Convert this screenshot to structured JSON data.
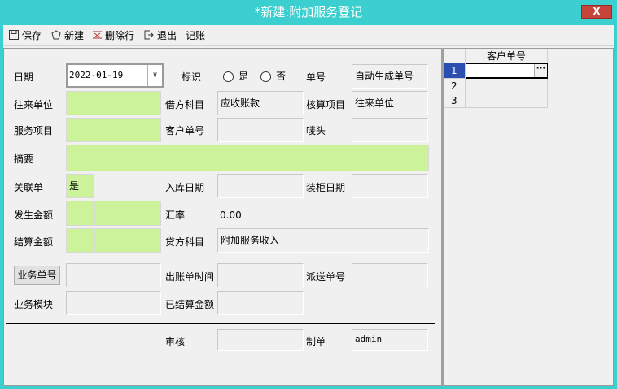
{
  "window": {
    "title": "*新建:附加服务登记",
    "close_label": "X"
  },
  "toolbar": {
    "save": "保存",
    "new": "新建",
    "delete_row": "删除行",
    "exit": "退出",
    "post": "记账"
  },
  "form": {
    "date_label": "日期",
    "date_value": "2022-01-19",
    "flag_label": "标识",
    "flag_yes": "是",
    "flag_no": "否",
    "order_no_label": "单号",
    "order_no_value": "自动生成单号",
    "partner_label": "往来单位",
    "partner_value": "",
    "debit_label": "借方科目",
    "debit_value": "应收账款",
    "accounting_item_label": "核算项目",
    "accounting_item_value": "往来单位",
    "service_item_label": "服务项目",
    "service_item_value": "",
    "customer_no_label": "客户单号",
    "customer_no_value": "",
    "mark_label": "唛头",
    "mark_value": "",
    "summary_label": "摘要",
    "summary_value": "",
    "related_label": "关联单",
    "related_value": "是",
    "inbound_date_label": "入库日期",
    "inbound_date_value": "",
    "loading_date_label": "装柜日期",
    "loading_date_value": "",
    "amount_label": "发生金额",
    "exchange_label": "汇率",
    "exchange_value": "0.00",
    "settle_amount_label": "结算金额",
    "credit_label": "贷方科目",
    "credit_value": "附加服务收入",
    "business_no_button": "业务单号",
    "billing_time_label": "出账单时间",
    "dispatch_no_label": "派送单号",
    "business_module_label": "业务模块",
    "settled_amount_label": "已结算金额",
    "audit_label": "审核",
    "audit_value": "",
    "maker_label": "制单",
    "maker_value": "admin"
  },
  "grid": {
    "header": "客户单号",
    "rows": [
      "1",
      "2",
      "3"
    ],
    "ellipsis": "···"
  }
}
